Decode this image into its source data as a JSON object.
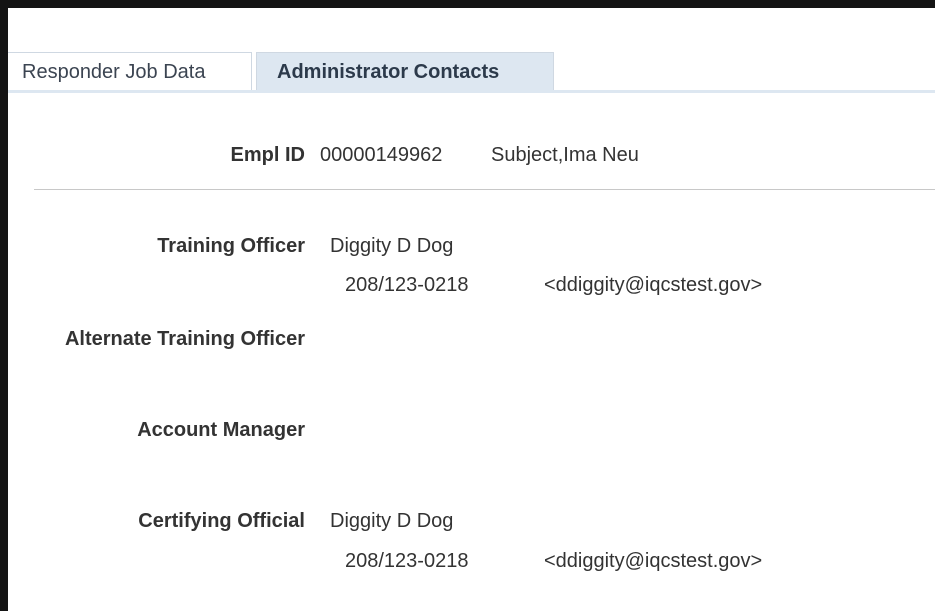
{
  "tabs": [
    {
      "label": "Responder Job Data",
      "active": false
    },
    {
      "label": "Administrator Contacts",
      "active": true
    }
  ],
  "employee": {
    "empl_id_label": "Empl ID",
    "empl_id": "00000149962",
    "name": "Subject,Ima Neu"
  },
  "contacts": {
    "training_officer": {
      "label": "Training Officer",
      "name": "Diggity D Dog",
      "phone": "208/123-0218",
      "email": "<ddiggity@iqcstest.gov>"
    },
    "alternate_training_officer": {
      "label": "Alternate Training Officer"
    },
    "account_manager": {
      "label": "Account Manager"
    },
    "certifying_official": {
      "label": "Certifying Official",
      "name": "Diggity D Dog",
      "phone": "208/123-0218",
      "email": "<ddiggity@iqcstest.gov>"
    }
  },
  "colors": {
    "active_tab_bg": "#dde7f1",
    "text": "#333333",
    "frame": "#141414"
  }
}
